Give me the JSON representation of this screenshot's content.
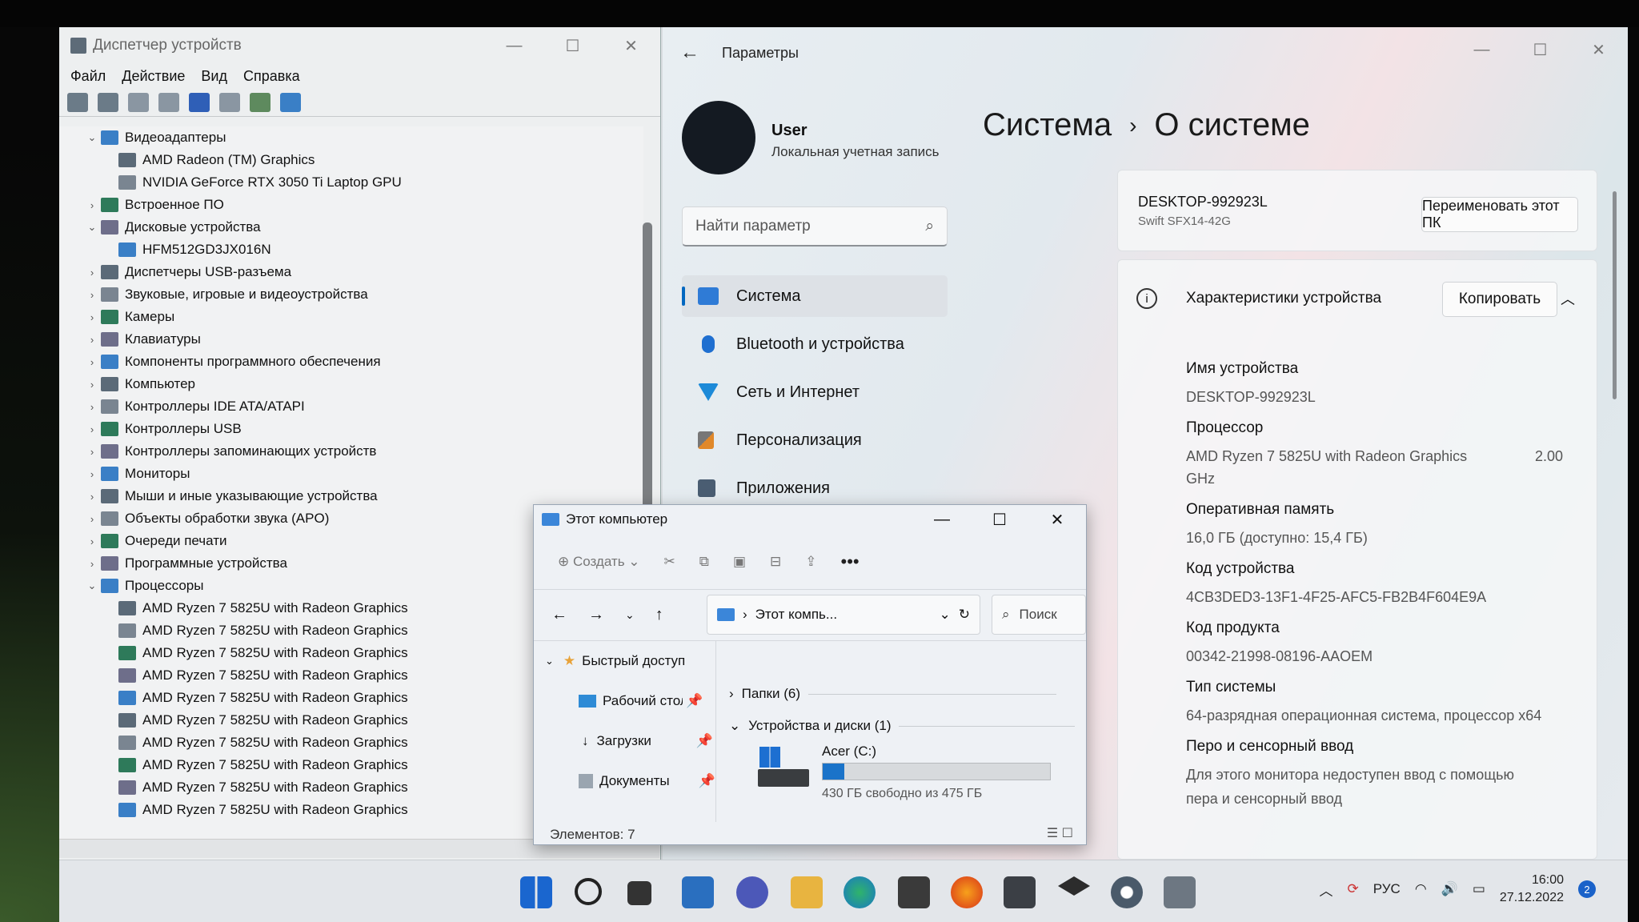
{
  "device_manager": {
    "title": "Диспетчер устройств",
    "menu": [
      "Файл",
      "Действие",
      "Вид",
      "Справка"
    ],
    "tree": [
      {
        "label": "Видеоадаптеры",
        "expanded": true,
        "level": 0
      },
      {
        "label": "AMD Radeon (TM) Graphics",
        "level": 1
      },
      {
        "label": "NVIDIA GeForce RTX 3050 Ti Laptop GPU",
        "level": 1
      },
      {
        "label": "Встроенное ПО",
        "level": 0
      },
      {
        "label": "Дисковые устройства",
        "expanded": true,
        "level": 0
      },
      {
        "label": "HFM512GD3JX016N",
        "level": 1
      },
      {
        "label": "Диспетчеры USB-разъема",
        "level": 0
      },
      {
        "label": "Звуковые, игровые и видеоустройства",
        "level": 0
      },
      {
        "label": "Камеры",
        "level": 0
      },
      {
        "label": "Клавиатуры",
        "level": 0
      },
      {
        "label": "Компоненты программного обеспечения",
        "level": 0
      },
      {
        "label": "Компьютер",
        "level": 0
      },
      {
        "label": "Контроллеры IDE ATA/ATAPI",
        "level": 0
      },
      {
        "label": "Контроллеры USB",
        "level": 0
      },
      {
        "label": "Контроллеры запоминающих устройств",
        "level": 0
      },
      {
        "label": "Мониторы",
        "level": 0
      },
      {
        "label": "Мыши и иные указывающие устройства",
        "level": 0
      },
      {
        "label": "Объекты обработки звука (APO)",
        "level": 0
      },
      {
        "label": "Очереди печати",
        "level": 0
      },
      {
        "label": "Программные устройства",
        "level": 0
      },
      {
        "label": "Процессоры",
        "expanded": true,
        "level": 0
      },
      {
        "label": "AMD Ryzen 7 5825U with Radeon Graphics",
        "level": 1
      },
      {
        "label": "AMD Ryzen 7 5825U with Radeon Graphics",
        "level": 1
      },
      {
        "label": "AMD Ryzen 7 5825U with Radeon Graphics",
        "level": 1
      },
      {
        "label": "AMD Ryzen 7 5825U with Radeon Graphics",
        "level": 1
      },
      {
        "label": "AMD Ryzen 7 5825U with Radeon Graphics",
        "level": 1
      },
      {
        "label": "AMD Ryzen 7 5825U with Radeon Graphics",
        "level": 1
      },
      {
        "label": "AMD Ryzen 7 5825U with Radeon Graphics",
        "level": 1
      },
      {
        "label": "AMD Ryzen 7 5825U with Radeon Graphics",
        "level": 1
      },
      {
        "label": "AMD Ryzen 7 5825U with Radeon Graphics",
        "level": 1
      },
      {
        "label": "AMD Ryzen 7 5825U with Radeon Graphics",
        "level": 1
      }
    ]
  },
  "settings": {
    "title": "Параметры",
    "user_name": "User",
    "user_type": "Локальная учетная запись",
    "search_placeholder": "Найти параметр",
    "nav": [
      "Система",
      "Bluetooth и устройства",
      "Сеть и Интернет",
      "Персонализация",
      "Приложения"
    ],
    "breadcrumb_parent": "Система",
    "breadcrumb_current": "О системе",
    "pc_name": "DESKTOP-992923L",
    "pc_model": "Swift SFX14-42G",
    "rename_button": "Переименовать этот ПК",
    "specs_title": "Характеристики устройства",
    "copy_button": "Копировать",
    "specs": [
      {
        "label": "Имя устройства",
        "value": "DESKTOP-992923L"
      },
      {
        "label": "Процессор",
        "value": "AMD Ryzen 7 5825U with Radeon Graphics",
        "value_extra": "2.00",
        "value_line2": "GHz"
      },
      {
        "label": "Оперативная память",
        "value": "16,0 ГБ (доступно: 15,4 ГБ)"
      },
      {
        "label": "Код устройства",
        "value": "4CB3DED3-13F1-4F25-AFC5-FB2B4F604E9A"
      },
      {
        "label": "Код продукта",
        "value": "00342-21998-08196-AAOEM"
      },
      {
        "label": "Тип системы",
        "value": "64-разрядная операционная система, процессор x64"
      },
      {
        "label": "Перо и сенсорный ввод",
        "value": "Для этого монитора недоступен ввод с помощью",
        "value_line2": "пера и сенсорный ввод"
      }
    ]
  },
  "explorer": {
    "title": "Этот компьютер",
    "new_label": "Создать",
    "address": "Этот компь...",
    "search": "Поиск",
    "sidebar": [
      "Быстрый доступ",
      "Рабочий стол",
      "Загрузки",
      "Документы"
    ],
    "group_folders": "Папки (6)",
    "group_devices": "Устройства и диски (1)",
    "drive_name": "Acer (C:)",
    "drive_free": "430 ГБ свободно из 475 ГБ",
    "drive_used_fraction": 0.095,
    "status": "Элементов: 7"
  },
  "taskbar": {
    "lang": "РУС",
    "time": "16:00",
    "date": "27.12.2022",
    "notifications": "2",
    "accent": "#0067c0"
  }
}
